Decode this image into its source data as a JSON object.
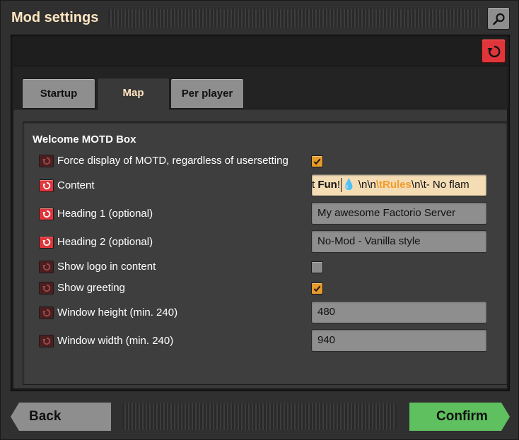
{
  "window": {
    "title": "Mod settings"
  },
  "tabs": [
    {
      "label": "Startup"
    },
    {
      "label": "Map"
    },
    {
      "label": "Per player"
    }
  ],
  "section": {
    "title": "Welcome MOTD Box"
  },
  "settings": [
    {
      "label": "Force display of MOTD, regardless of usersetting",
      "type": "checkbox",
      "checked": true,
      "reset_active": false
    },
    {
      "label": "Content",
      "type": "text",
      "reset_active": true,
      "value_parts": [
        "t ",
        "Fun",
        "!",
        "💧",
        " \\n\\n",
        "\\tRules",
        "\\n\\t- No flam"
      ]
    },
    {
      "label": "Heading 1 (optional)",
      "type": "text",
      "value": "My awesome Factorio Server",
      "reset_active": true
    },
    {
      "label": "Heading 2 (optional)",
      "type": "text",
      "value": "No-Mod - Vanilla style",
      "reset_active": true
    },
    {
      "label": "Show logo in content",
      "type": "checkbox",
      "checked": false,
      "reset_active": false
    },
    {
      "label": "Show greeting",
      "type": "checkbox",
      "checked": true,
      "reset_active": false
    },
    {
      "label": "Window height (min. 240)",
      "type": "text",
      "value": "480",
      "reset_active": false
    },
    {
      "label": "Window width (min. 240)",
      "type": "text",
      "value": "940",
      "reset_active": false
    }
  ],
  "footer": {
    "back_label": "Back",
    "confirm_label": "Confirm"
  },
  "icons": {
    "search": "magnifier-icon",
    "reset": "reset-arrow-icon",
    "check": "checkmark-icon"
  },
  "colors": {
    "title": "#ffe6c0",
    "reset_active": "#e0363b",
    "reset_inactive": "#4b1f20",
    "checkbox_checked": "#e59a2c",
    "confirm": "#5ec05e",
    "highlight_text": "#f29b2b"
  }
}
